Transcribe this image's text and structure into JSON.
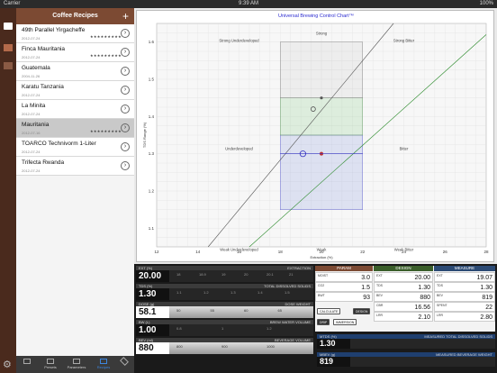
{
  "status": {
    "carrier": "Carrier",
    "time": "9:39 AM",
    "battery": "100%"
  },
  "rail": {
    "icons": [
      "doc-icon",
      "flask-icon",
      "layers-icon",
      "gear-icon"
    ]
  },
  "sidebar": {
    "title": "Coffee Recipes",
    "add": "+",
    "items": [
      {
        "title": "49th Parallel Yirgacheffe",
        "date": "2012-07-24",
        "stars": "★★★★★★★★★",
        "selected": false
      },
      {
        "title": "Finca Mauritania",
        "date": "2012-07-24",
        "stars": "★★★★★★★★★",
        "selected": false
      },
      {
        "title": "Guatemala",
        "date": "2004-11-26",
        "stars": "",
        "selected": false
      },
      {
        "title": "Karatu Tanzania",
        "date": "2012-07-24",
        "stars": "",
        "selected": false
      },
      {
        "title": "La Minita",
        "date": "2012-07-24",
        "stars": "",
        "selected": false
      },
      {
        "title": "Mauritania",
        "date": "2012-07-16",
        "stars": "★★★★★★★★★",
        "selected": true
      },
      {
        "title": "TOARCO Technivorm 1-Liter",
        "date": "2012-07-24",
        "stars": "",
        "selected": false
      },
      {
        "title": "Trifecta Rwanda",
        "date": "2012-07-24",
        "stars": "",
        "selected": false
      }
    ]
  },
  "tabs": [
    {
      "label": "Presets"
    },
    {
      "label": "Parameters"
    },
    {
      "label": "Recipes"
    }
  ],
  "chart": {
    "title": "Universal Brewing Control Chart™",
    "xlabel": "Extraction (%)",
    "ylabel": "TDS Range (%)",
    "xticks": [
      "12",
      "14",
      "16",
      "18",
      "20",
      "22",
      "24",
      "26",
      "28"
    ],
    "yticks": [
      "1.6",
      "1.5",
      "1.4",
      "1.3",
      "1.2",
      "1.1"
    ],
    "zones": [
      "Strong",
      "Strong Underdeveloped",
      "Strong Bitter",
      "Underdeveloped",
      "Bitter",
      "Weak Underdeveloped",
      "Weak",
      "Weak Bitter"
    ]
  },
  "chart_data": {
    "type": "scatter",
    "xlim": [
      12,
      28
    ],
    "ylim": [
      1.05,
      1.65
    ],
    "points": [
      {
        "x": 19.1,
        "y": 1.3
      },
      {
        "x": 20.0,
        "y": 1.3
      },
      {
        "x": 19.6,
        "y": 1.42
      },
      {
        "x": 20.0,
        "y": 1.45
      }
    ]
  },
  "gauges": [
    {
      "id": "ext",
      "head": "EXT (%)",
      "rt": "EXTRACTION",
      "value": "20.00",
      "ticks": [
        "18",
        "18.9",
        "19",
        "20",
        "20.1",
        "21"
      ]
    },
    {
      "id": "tds",
      "head": "TDS (%)",
      "rt": "TOTAL DISSOLVED SOLIDS",
      "value": "1.30",
      "ticks": [
        "1.1",
        "1.2",
        "1.3",
        "1.4",
        "1.5"
      ]
    },
    {
      "id": "dose",
      "head": "DOSE (g)",
      "rt": "DOSE WEIGHT",
      "value": "58.1",
      "ticks": [
        "50",
        "55",
        "60",
        "65"
      ]
    },
    {
      "id": "bw",
      "head": "BW (L)",
      "rt": "BREW WATER VOLUME",
      "value": "1.00",
      "ticks": [
        "0.8",
        "1",
        "1.2"
      ]
    },
    {
      "id": "bev",
      "head": "BEV (ml)",
      "rt": "BEVERAGE VOLUME",
      "value": "880",
      "ticks": [
        "800",
        "900",
        "1000"
      ]
    }
  ],
  "table": {
    "headers": [
      "PARAM",
      "DESIGN",
      "MEASURE"
    ],
    "param": [
      {
        "k": "MOIST",
        "v": "3.0"
      },
      {
        "k": "CO2",
        "v": "1.5"
      },
      {
        "k": "BWT",
        "v": "93"
      }
    ],
    "design": [
      {
        "k": "EXT",
        "v": "20.00"
      },
      {
        "k": "TDS",
        "v": "1.30"
      },
      {
        "k": "BEV",
        "v": "880"
      },
      {
        "k": "CBR",
        "v": "16.56"
      },
      {
        "k": "LRR",
        "v": "2.10"
      }
    ],
    "measure": [
      {
        "k": "EXT",
        "v": "19.07"
      },
      {
        "k": "TDS",
        "v": "1.30"
      },
      {
        "k": "BEV",
        "v": "819"
      },
      {
        "k": "SPENT",
        "v": "22"
      },
      {
        "k": "LRR",
        "v": "2.80"
      }
    ],
    "buttons": {
      "calc": "CALCULATE",
      "design": "DESIGN",
      "drip": "DRIP",
      "imm": "IMMERSION"
    }
  },
  "mtds": {
    "head": "MTDS (%)",
    "rt": "MEASURED TOTAL DISSOLVED SOLIDS",
    "value": "1.30"
  },
  "mbev": {
    "head": "MBEV (g)",
    "rt": "MEASURED BEVERAGE WEIGHT",
    "value": "819"
  }
}
